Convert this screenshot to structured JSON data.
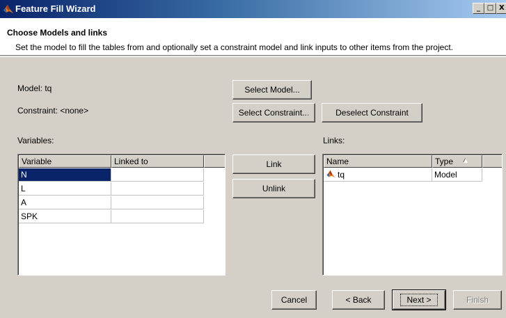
{
  "window": {
    "title": "Feature Fill Wizard",
    "controls": {
      "minimize": "_",
      "maximize": "□",
      "close": "X"
    }
  },
  "header": {
    "title": "Choose Models and links",
    "subtitle": "Set the model to fill the tables from and optionally set a constraint model and link inputs to other items from the project."
  },
  "model": {
    "label": "Model: tq",
    "select_button": "Select Model..."
  },
  "constraint": {
    "label": "Constraint: <none>",
    "select_button": "Select Constraint...",
    "deselect_button": "Deselect Constraint"
  },
  "variables": {
    "label": "Variables:",
    "columns": [
      "Variable",
      "Linked to"
    ],
    "rows": [
      {
        "variable": "N",
        "linked_to": ""
      },
      {
        "variable": "L",
        "linked_to": ""
      },
      {
        "variable": "A",
        "linked_to": ""
      },
      {
        "variable": "SPK",
        "linked_to": ""
      }
    ],
    "selected_row": 0
  },
  "link_buttons": {
    "link": "Link",
    "unlink": "Unlink"
  },
  "links": {
    "label": "Links:",
    "columns": [
      "Name",
      "Type"
    ],
    "sort_indicator": "▲",
    "rows": [
      {
        "name": "tq",
        "type": "Model",
        "icon": "matlab-model-icon"
      }
    ]
  },
  "footer": {
    "cancel": "Cancel",
    "back": "< Back",
    "next": "Next >",
    "finish": "Finish"
  },
  "colors": {
    "titlebar_start": "#0a246a",
    "titlebar_end": "#a6caf0",
    "dialog_bg": "#d4d0c8",
    "selection": "#0a246a"
  }
}
